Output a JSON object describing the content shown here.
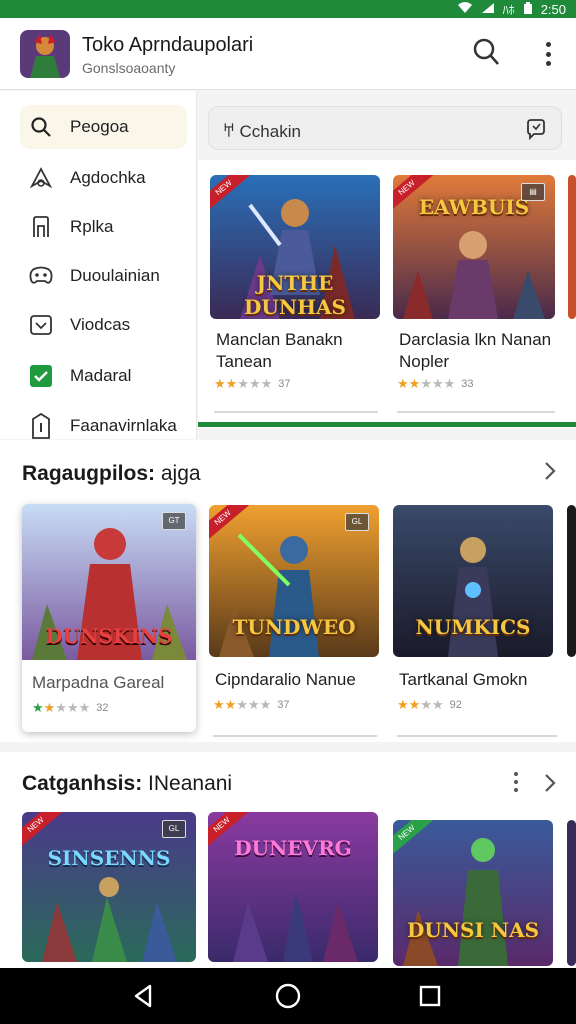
{
  "status_bar": {
    "time": "2:50",
    "badge": "ﾊﾎ"
  },
  "app_bar": {
    "title": "Toko Aprndaupolari",
    "subtitle": "Gonslsoaoanty"
  },
  "drawer": {
    "items": [
      {
        "label": "Peogoa",
        "icon": "search-icon"
      },
      {
        "label": "Agdochka",
        "icon": "map-pin-icon"
      },
      {
        "label": "Rplka",
        "icon": "bookmark-icon"
      },
      {
        "label": "Duoulainian",
        "icon": "gamepad-icon"
      },
      {
        "label": "Viodcas",
        "icon": "video-icon"
      },
      {
        "label": "Madaral",
        "icon": "check-icon"
      },
      {
        "label": "Faanavirnlaka",
        "icon": "info-icon"
      }
    ]
  },
  "search": {
    "text": "𐀀 Cchakin"
  },
  "top_row": [
    {
      "title_line1": "Manclan Banakn",
      "title_line2": "Tanean",
      "rating": 2,
      "score": "37",
      "thumb_text": "JNTHE DUNHAS",
      "ribbon": "NEW",
      "badge": ""
    },
    {
      "title_line1": "Darclasia lkn Nanan",
      "title_line2": "Nopler",
      "rating": 2,
      "score": "33",
      "thumb_text": "EAWBUIS",
      "ribbon": "NEW",
      "badge": "▤"
    }
  ],
  "section1": {
    "title_bold": "Ragaugpilos:",
    "title_light": "ajga",
    "cards": [
      {
        "title": "Marpadna Gareal",
        "rating": 2,
        "score": "32",
        "thumb_text": "DUNSKINS",
        "ribbon": "",
        "badge": "GT"
      },
      {
        "title": "Cipndaralio Nanue",
        "rating": 2,
        "score": "37",
        "thumb_text": "TUNDWEO",
        "ribbon": "NEW",
        "badge": "GL"
      },
      {
        "title": "Tartkanal Gmokn",
        "rating": 2,
        "score": "92",
        "thumb_text": "NUMKICS",
        "ribbon": "",
        "badge": ""
      }
    ]
  },
  "section2": {
    "title_bold": "Catganhsis:",
    "title_light": "INeanani",
    "cards": [
      {
        "thumb_text": "SINSENNS",
        "ribbon": "NEW",
        "badge": "GL"
      },
      {
        "thumb_text": "DUNEVRG",
        "ribbon": "NEW",
        "badge": ""
      },
      {
        "thumb_text": "DUNSI NAS",
        "ribbon": "NEW",
        "badge": ""
      }
    ]
  },
  "colors": {
    "accent_green": "#1f8a3a",
    "star": "#f0a020",
    "ribbon": "#c8202a"
  }
}
